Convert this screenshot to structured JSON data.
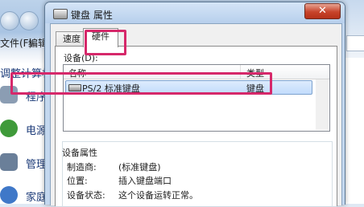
{
  "background_window": {
    "menu": [
      "文件(F)",
      "编辑"
    ],
    "heading": "调整计算机",
    "items": [
      {
        "label": "程序",
        "icon": "programs-icon",
        "color": "#8b9db3"
      },
      {
        "label": "电源",
        "icon": "power-icon",
        "color": "#3f9a3a"
      },
      {
        "label": "管理",
        "icon": "manage-icon",
        "color": "#6a7f99"
      },
      {
        "label": "家庭",
        "icon": "homegroup-icon",
        "color": "#3f78c8"
      }
    ]
  },
  "dialog": {
    "title": "键盘 属性",
    "close_glyph": "✕",
    "tabs": [
      {
        "label": "速度",
        "active": false
      },
      {
        "label": "硬件",
        "active": true
      }
    ],
    "devices_label": "设备(D):",
    "list_columns": {
      "name": "名称",
      "type": "类型"
    },
    "devices": [
      {
        "name": "PS/2 标准键盘",
        "type": "键盘",
        "selected": true,
        "icon": "keyboard-icon"
      }
    ],
    "properties": {
      "title": "设备属性",
      "rows": [
        {
          "label": "制造商:",
          "value": "(标准键盘)"
        },
        {
          "label": "位置:",
          "value": "插入键盘端口"
        },
        {
          "label": "设备状态:",
          "value": "这个设备运转正常。"
        }
      ]
    }
  },
  "colors": {
    "highlight": "#d6286a",
    "selection": "#c2dcfc",
    "close_button": "#c7432a"
  }
}
